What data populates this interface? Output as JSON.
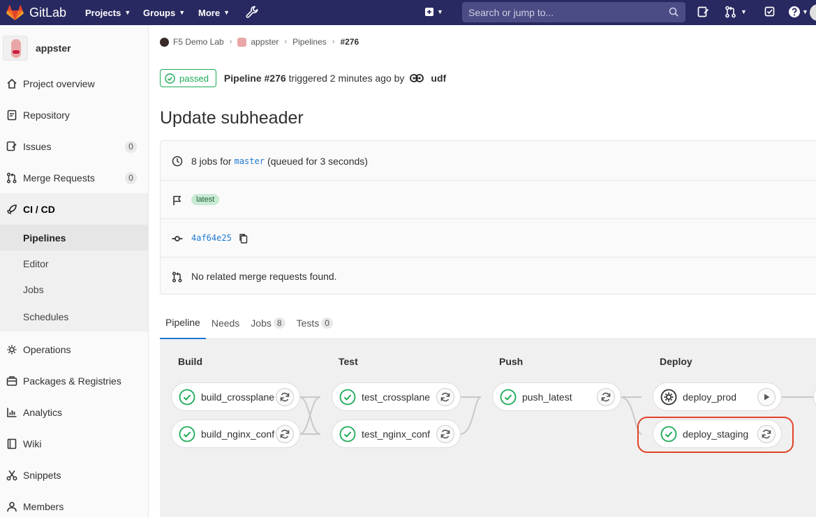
{
  "navbar": {
    "brand": "GitLab",
    "menu": [
      {
        "label": "Projects"
      },
      {
        "label": "Groups"
      },
      {
        "label": "More"
      }
    ],
    "search_placeholder": "Search or jump to...",
    "icons": [
      "gitlab-logo-icon",
      "wrench-icon",
      "plus-square-icon",
      "search-icon",
      "issues-icon",
      "merge-request-icon",
      "todo-icon",
      "help-icon",
      "user-avatar-icon"
    ]
  },
  "sidebar": {
    "project_name": "appster",
    "items": [
      {
        "label": "Project overview",
        "icon": "home-icon"
      },
      {
        "label": "Repository",
        "icon": "doc-icon"
      },
      {
        "label": "Issues",
        "icon": "issues-icon",
        "count": "0"
      },
      {
        "label": "Merge Requests",
        "icon": "merge-request-icon",
        "count": "0"
      },
      {
        "label": "CI / CD",
        "icon": "rocket-icon"
      },
      {
        "label": "Operations",
        "icon": "cloud-gear-icon"
      },
      {
        "label": "Packages & Registries",
        "icon": "package-icon"
      },
      {
        "label": "Analytics",
        "icon": "chart-icon"
      },
      {
        "label": "Wiki",
        "icon": "book-icon"
      },
      {
        "label": "Snippets",
        "icon": "scissors-icon"
      },
      {
        "label": "Members",
        "icon": "users-icon"
      }
    ],
    "cicd_sub": [
      {
        "label": "Pipelines"
      },
      {
        "label": "Editor"
      },
      {
        "label": "Jobs"
      },
      {
        "label": "Schedules"
      }
    ]
  },
  "breadcrumbs": [
    "F5 Demo Lab",
    "appster",
    "Pipelines",
    "#276"
  ],
  "pipeline": {
    "status": "passed",
    "title": "Pipeline #276",
    "triggered": "triggered 2 minutes ago by",
    "user": "udf",
    "commit_title": "Update subheader"
  },
  "info": {
    "jobs_prefix": "8 jobs for",
    "branch": "master",
    "queued": "(queued for 3 seconds)",
    "tag": "latest",
    "sha": "4af64e25",
    "mr_text": "No related merge requests found."
  },
  "tabs": [
    {
      "label": "Pipeline"
    },
    {
      "label": "Needs"
    },
    {
      "label": "Jobs",
      "count": "8"
    },
    {
      "label": "Tests",
      "count": "0"
    }
  ],
  "stages": [
    {
      "name": "Build",
      "jobs": [
        {
          "name": "build_crossplane",
          "action": "retry"
        },
        {
          "name": "build_nginx_conf",
          "action": "retry"
        }
      ]
    },
    {
      "name": "Test",
      "jobs": [
        {
          "name": "test_crossplane",
          "action": "retry"
        },
        {
          "name": "test_nginx_conf",
          "action": "retry"
        }
      ]
    },
    {
      "name": "Push",
      "jobs": [
        {
          "name": "push_latest",
          "action": "retry"
        }
      ]
    },
    {
      "name": "Deploy",
      "jobs": [
        {
          "name": "deploy_prod",
          "action": "play",
          "status": "manual"
        },
        {
          "name": "deploy_staging",
          "action": "retry"
        }
      ]
    }
  ],
  "colors": {
    "navbar": "#292961",
    "success": "#1aaa55",
    "link": "#1f78d1",
    "highlight": "#e24329"
  }
}
